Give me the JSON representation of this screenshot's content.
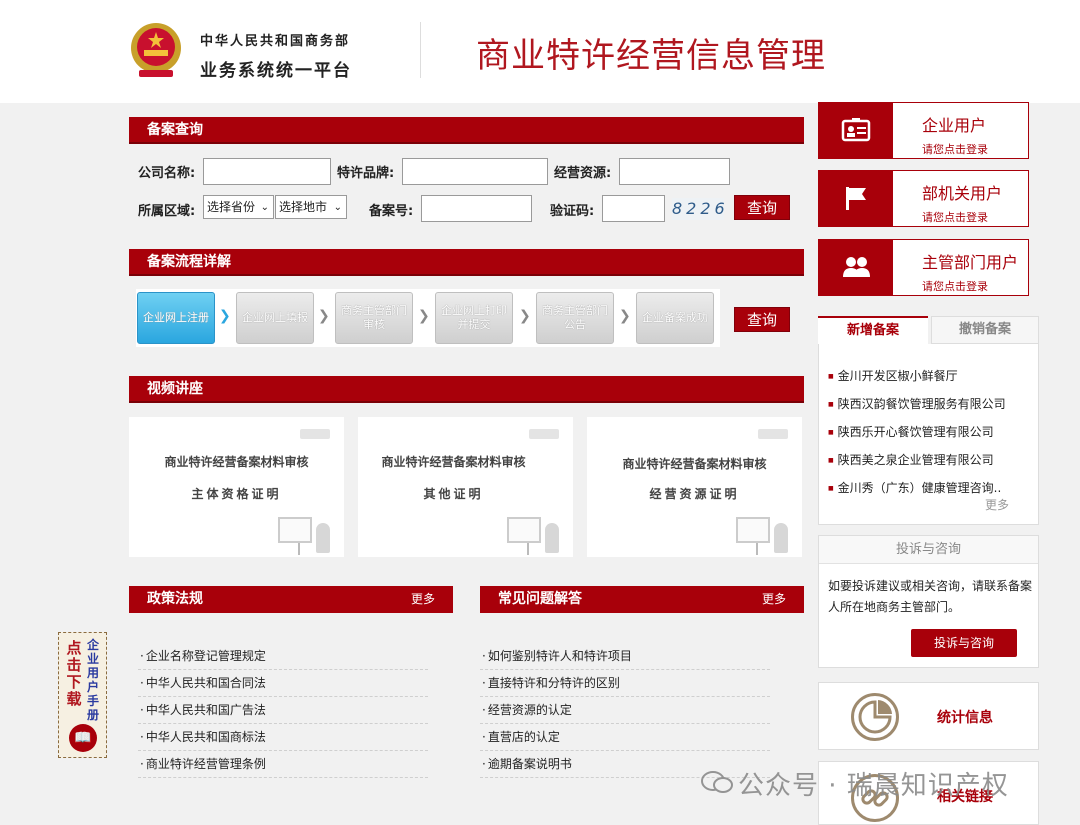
{
  "header": {
    "org_line1": "中华人民共和国商务部",
    "org_line2": "业务系统统一平台",
    "site_title": "商业特许经营信息管理"
  },
  "query": {
    "title": "备案查询",
    "company_label": "公司名称:",
    "brand_label": "特许品牌:",
    "resource_label": "经营资源:",
    "region_label": "所属区域:",
    "province_select": "选择省份",
    "city_select": "选择地市",
    "record_no_label": "备案号:",
    "captcha_label": "验证码:",
    "captcha_value": "8226",
    "search_button": "查询"
  },
  "process": {
    "title": "备案流程详解",
    "steps": [
      "企业网上注册",
      "企业网上填报",
      "商务主管部门审核",
      "企业网上打印并提交",
      "商务主管部门公告",
      "企业备案成功"
    ],
    "button": "查询"
  },
  "video": {
    "title": "视频讲座",
    "cards": [
      {
        "line1": "商业特许经营备案材料审核",
        "line2": "主体资格证明"
      },
      {
        "line1": "商业特许经营备案材料审核",
        "line2": "其他证明"
      },
      {
        "line1": "商业特许经营备案材料审核",
        "line2": "经营资源证明"
      }
    ]
  },
  "policy": {
    "title": "政策法规",
    "more": "更多",
    "items": [
      "企业名称登记管理规定",
      "中华人民共和国合同法",
      "中华人民共和国广告法",
      "中华人民共和国商标法",
      "商业特许经营管理条例"
    ]
  },
  "faq": {
    "title": "常见问题解答",
    "more": "更多",
    "items": [
      "如何鉴别特许人和特许项目",
      "直接特许和分特许的区别",
      "经营资源的认定",
      "直营店的认定",
      "逾期备案说明书"
    ]
  },
  "download": {
    "text1": "点击下载",
    "text2": "企业用户手册"
  },
  "sidebar": {
    "users": [
      {
        "name": "企业用户",
        "hint": "请您点击登录",
        "icon": "id-card-icon"
      },
      {
        "name": "部机关用户",
        "hint": "请您点击登录",
        "icon": "flag-icon"
      },
      {
        "name": "主管部门用户",
        "hint": "请您点击登录",
        "icon": "users-icon"
      }
    ],
    "tab_new": "新增备案",
    "tab_cancel": "撤销备案",
    "recent": [
      "金川开发区椒小鲜餐厅",
      "陕西汉韵餐饮管理服务有限公司",
      "陕西乐开心餐饮管理有限公司",
      "陕西美之泉企业管理有限公司",
      "金川秀（广东）健康管理咨询.."
    ],
    "recent_more": "更多",
    "complaint_title": "投诉与咨询",
    "complaint_text": "如要投诉建议或相关咨询，请联系备案人所在地商务主管部门。",
    "complaint_button": "投诉与咨询",
    "stats_label": "统计信息",
    "links_label": "相关链接"
  },
  "watermark": "公众号 · 瑞晨知识产权",
  "colors": {
    "brand_red": "#a8000a",
    "title_red": "#b0171f",
    "step_active": "#2aa6df"
  }
}
